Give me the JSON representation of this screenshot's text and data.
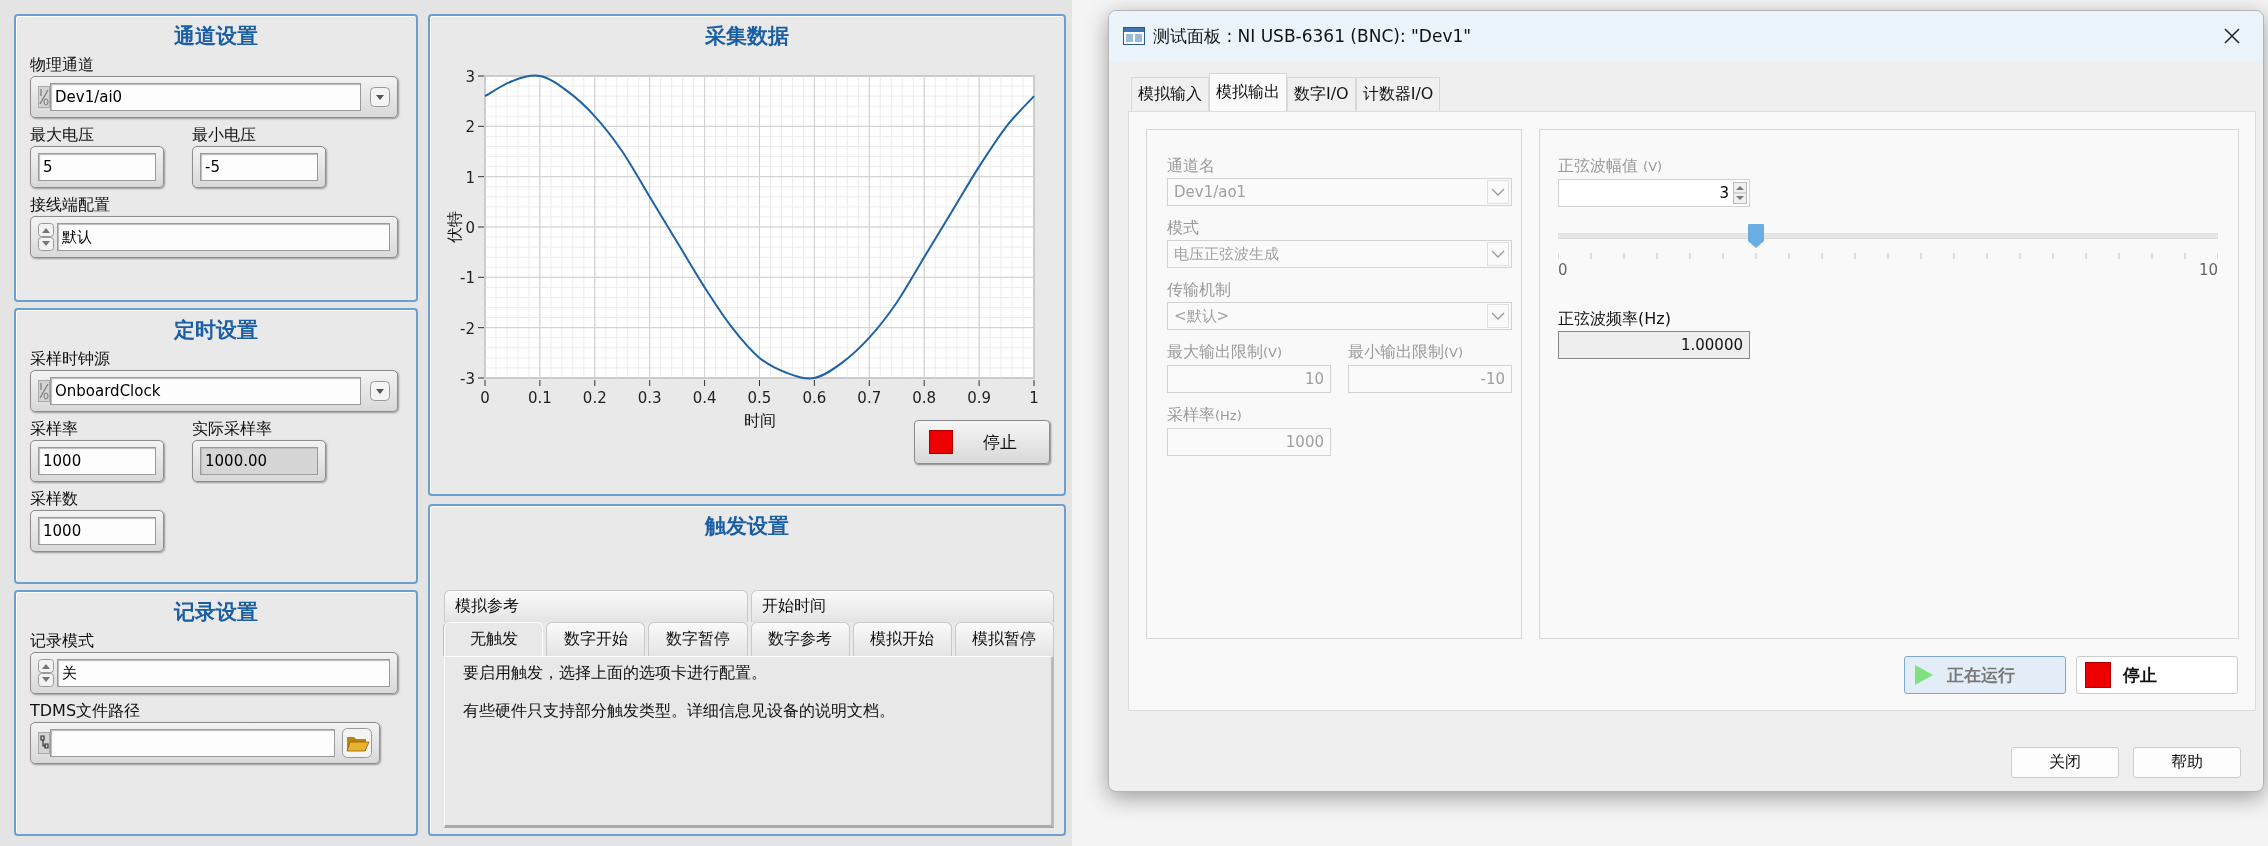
{
  "front_panel": {
    "settings_panels": [
      {
        "title": "通道设置",
        "fields": [
          {
            "kind": "io",
            "label": "物理通道",
            "value": "Dev1/ai0"
          },
          {
            "kind": "numeric",
            "label": "最大电压",
            "value": "5"
          },
          {
            "kind": "numeric",
            "label": "最小电压",
            "value": "-5"
          },
          {
            "kind": "ring",
            "label": "接线端配置",
            "value": "默认"
          }
        ]
      },
      {
        "title": "定时设置",
        "fields": [
          {
            "kind": "io",
            "label": "采样时钟源",
            "value": "OnboardClock"
          },
          {
            "kind": "numeric",
            "label": "采样率",
            "value": "1000"
          },
          {
            "kind": "indicator",
            "label": "实际采样率",
            "value": "1000.00"
          },
          {
            "kind": "numeric",
            "label": "采样数",
            "value": "1000"
          }
        ]
      },
      {
        "title": "记录设置",
        "fields": [
          {
            "kind": "ring",
            "label": "记录模式",
            "value": "关"
          },
          {
            "kind": "path",
            "label": "TDMS文件路径"
          }
        ]
      }
    ],
    "graph_panel": {
      "title": "采集数据",
      "chart_data": {
        "type": "line",
        "xlabel": "时间",
        "ylabel": "伏特",
        "x": [
          0,
          0.05,
          0.1,
          0.15,
          0.2,
          0.25,
          0.3,
          0.35,
          0.4,
          0.45,
          0.5,
          0.55,
          0.6,
          0.65,
          0.7,
          0.75,
          0.8,
          0.85,
          0.9,
          0.95,
          1
        ],
        "series": [
          {
            "color": "#1f63a6",
            "values": [
              2.6,
              2.9,
              3,
              2.7,
              2.2,
              1.5,
              0.6,
              -0.3,
              -1.2,
              -2,
              -2.6,
              -2.9,
              -3,
              -2.7,
              -2.2,
              -1.5,
              -0.6,
              0.3,
              1.2,
              2,
              2.6
            ]
          }
        ],
        "grid": true,
        "xlim": [
          0,
          1
        ],
        "ylim": [
          -3,
          3
        ],
        "xticks": [
          0,
          0.1,
          0.2,
          0.3,
          0.4,
          0.5,
          0.6,
          0.7,
          0.8,
          0.9,
          1
        ],
        "yticks": [
          -3,
          -2,
          -1,
          0,
          1,
          2,
          3
        ]
      },
      "stop_button": "停止"
    },
    "trigger_panel": {
      "title": "触发设置",
      "tab_rows": [
        [
          {
            "label": "模拟参考",
            "selected": false
          },
          {
            "label": "开始时间",
            "selected": false
          }
        ],
        [
          {
            "label": "无触发",
            "selected": true
          },
          {
            "label": "数字开始",
            "selected": false
          },
          {
            "label": "数字暂停",
            "selected": false
          },
          {
            "label": "数字参考",
            "selected": false
          },
          {
            "label": "模拟开始",
            "selected": false
          },
          {
            "label": "模拟暂停",
            "selected": false
          }
        ]
      ],
      "messages": [
        "要启用触发，选择上面的选项卡进行配置。",
        "有些硬件只支持部分触发类型。详细信息见设备的说明文档。"
      ]
    }
  },
  "test_panel": {
    "title": "测试面板 : NI USB-6361 (BNC): \"Dev1\"",
    "tabs": [
      {
        "label": "模拟输入",
        "selected": false
      },
      {
        "label": "模拟输出",
        "selected": true
      },
      {
        "label": "数字I/O",
        "selected": false
      },
      {
        "label": "计数器I/O",
        "selected": false
      }
    ],
    "channel_group": {
      "disabled": true,
      "fields": [
        {
          "kind": "dropdown",
          "label": "通道名",
          "value": "Dev1/ao1"
        },
        {
          "kind": "dropdown",
          "label": "模式",
          "value": "电压正弦波生成"
        },
        {
          "kind": "dropdown",
          "label": "传输机制",
          "value": "<默认>"
        },
        {
          "kind": "number",
          "label": "最大输出限制",
          "unit": "(V)",
          "value": "10"
        },
        {
          "kind": "number",
          "label": "最小输出限制",
          "unit": "(V)",
          "value": "-10"
        },
        {
          "kind": "number",
          "label": "采样率",
          "unit": "(Hz)",
          "value": "1000"
        }
      ]
    },
    "waveform_group": {
      "amplitude": {
        "label": "正弦波幅值",
        "unit": "(V)",
        "value": "3",
        "disabled": true,
        "level": 0.3,
        "scale_min": "0",
        "scale_max": "10"
      },
      "frequency": {
        "label": "正弦波频率(Hz)",
        "value": "1.00000"
      }
    },
    "run_button": {
      "label": "正在运行",
      "active": true
    },
    "stop_button": {
      "label": "停止"
    },
    "footer_buttons": [
      "关闭",
      "帮助"
    ]
  }
}
